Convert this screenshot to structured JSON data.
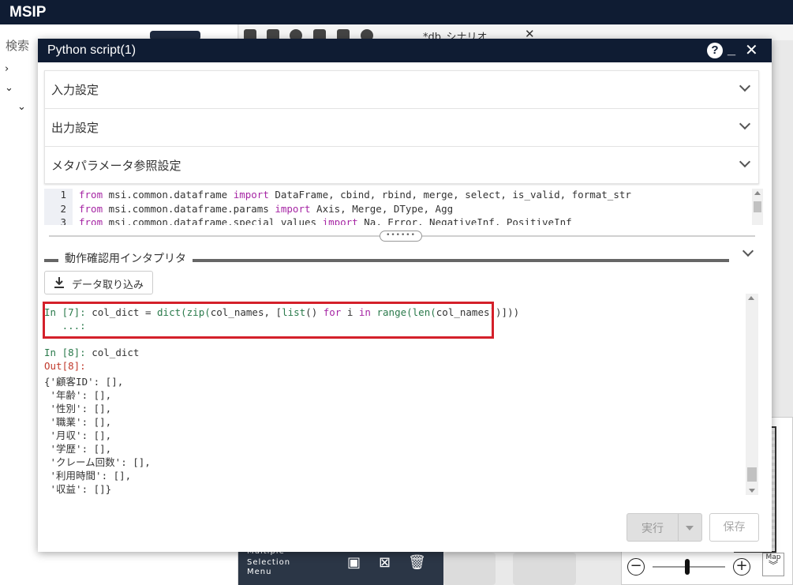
{
  "app": {
    "title": "MSIP"
  },
  "background": {
    "search_label": "検索",
    "tab_label": "*db_シナリオ",
    "tab_close": "✕",
    "menu_line1": "Multiple",
    "menu_line2": "Selection",
    "menu_line3": "Menu",
    "map_label": "Map"
  },
  "dialog": {
    "title": "Python script(1)",
    "help": "?",
    "minimize": "_",
    "close": "✕",
    "sections": [
      {
        "label": "入力設定"
      },
      {
        "label": "出力設定"
      },
      {
        "label": "メタパラメータ参照設定"
      }
    ],
    "code_lines": [
      {
        "num": "1",
        "kw1": "from ",
        "mod": "msi.common.dataframe ",
        "kw2": "import ",
        "rest": "DataFrame, cbind, rbind, merge, select, is_valid, format_str"
      },
      {
        "num": "2",
        "kw1": "from ",
        "mod": "msi.common.dataframe.params ",
        "kw2": "import ",
        "rest": "Axis, Merge, DType, Agg"
      },
      {
        "num": "3",
        "kw1": "from ",
        "mod": "msi.common.dataframe.special_values ",
        "kw2": "import ",
        "rest": "Na, Error, NegativeInf, PositiveInf"
      }
    ],
    "splitter_handle": "••••••",
    "interpreter_label": "動作確認用インタプリタ",
    "import_button": "データ取り込み",
    "console": {
      "in7_prompt": "In [7]: ",
      "in7_code_a": "col_dict = ",
      "in7_code_b": "dict(zip(",
      "in7_code_c": "col_names, [",
      "in7_code_d": "list",
      "in7_code_e": "() ",
      "in7_code_f": "for",
      "in7_code_g": " i ",
      "in7_code_h": "in",
      "in7_code_i": " ",
      "in7_code_j": "range(len(",
      "in7_code_k": "col_names))]))",
      "cont": "   ...:",
      "in8_prompt": "In [8]: ",
      "in8_code": "col_dict",
      "out8": "Out[8]:",
      "dict_lines": [
        "{'顧客ID': [],",
        " '年齢': [],",
        " '性別': [],",
        " '職業': [],",
        " '月収': [],",
        " '学歴': [],",
        " 'クレーム回数': [],",
        " '利用時間': [],",
        " '収益': []}"
      ]
    },
    "run_button": "実行",
    "save_button": "保存"
  }
}
